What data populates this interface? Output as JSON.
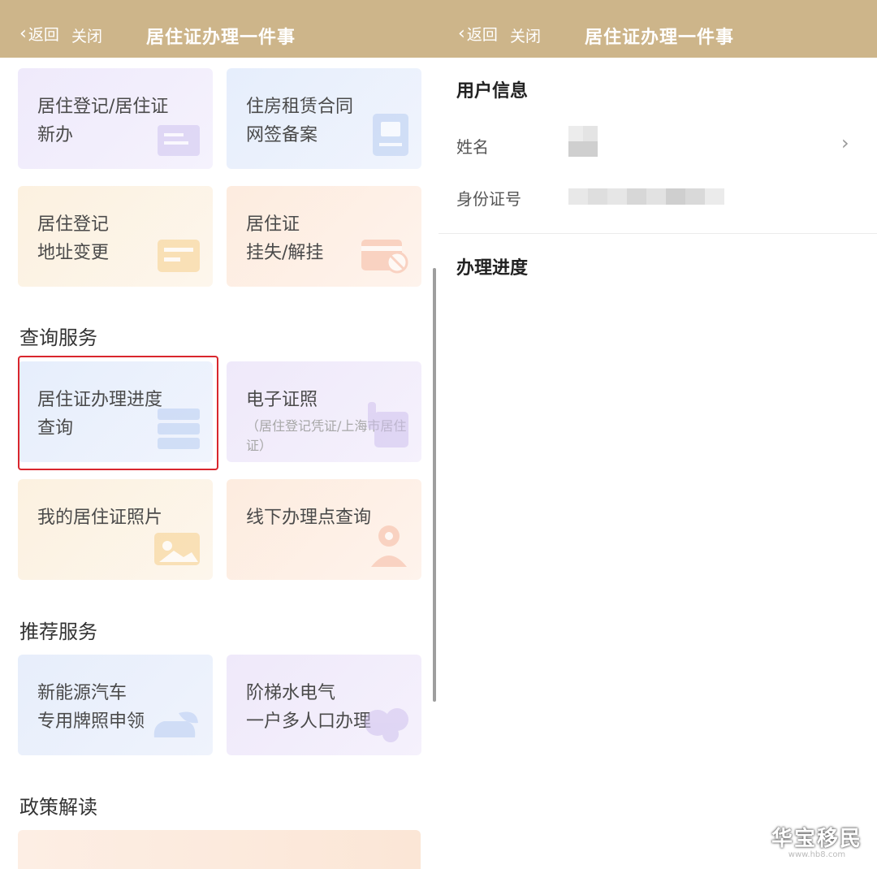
{
  "left": {
    "nav": {
      "back": "返回",
      "close": "关闭",
      "title": "居住证办理一件事"
    },
    "cards_top": [
      {
        "line1": "居住登记/居住证",
        "line2": "新办"
      },
      {
        "line1": "住房租赁合同",
        "line2": "网签备案"
      },
      {
        "line1": "居住登记",
        "line2": "地址变更"
      },
      {
        "line1": "居住证",
        "line2": "挂失/解挂"
      }
    ],
    "query_section": {
      "title": "查询服务",
      "cards": [
        {
          "line1": "居住证办理进度",
          "line2": "查询"
        },
        {
          "line1": "电子证照",
          "sub": "（居住登记凭证/上海市居住证）"
        },
        {
          "line1": "我的居住证照片"
        },
        {
          "line1": "线下办理点查询"
        }
      ]
    },
    "recommend_section": {
      "title": "推荐服务",
      "cards": [
        {
          "line1": "新能源汽车",
          "line2": "专用牌照申领"
        },
        {
          "line1": "阶梯水电气",
          "line2": "一户多人口办理"
        }
      ]
    },
    "policy_section": {
      "title": "政策解读"
    }
  },
  "right": {
    "nav": {
      "back": "返回",
      "close": "关闭",
      "title": "居住证办理一件事"
    },
    "user_info": {
      "title": "用户信息",
      "name_label": "姓名",
      "id_label": "身份证号"
    },
    "progress": {
      "title": "办理进度"
    }
  },
  "watermark": {
    "text": "华宝移民",
    "url": "www.hb8.com"
  },
  "colors": {
    "topbar": "#cdb58a",
    "highlight": "#d9262d"
  }
}
